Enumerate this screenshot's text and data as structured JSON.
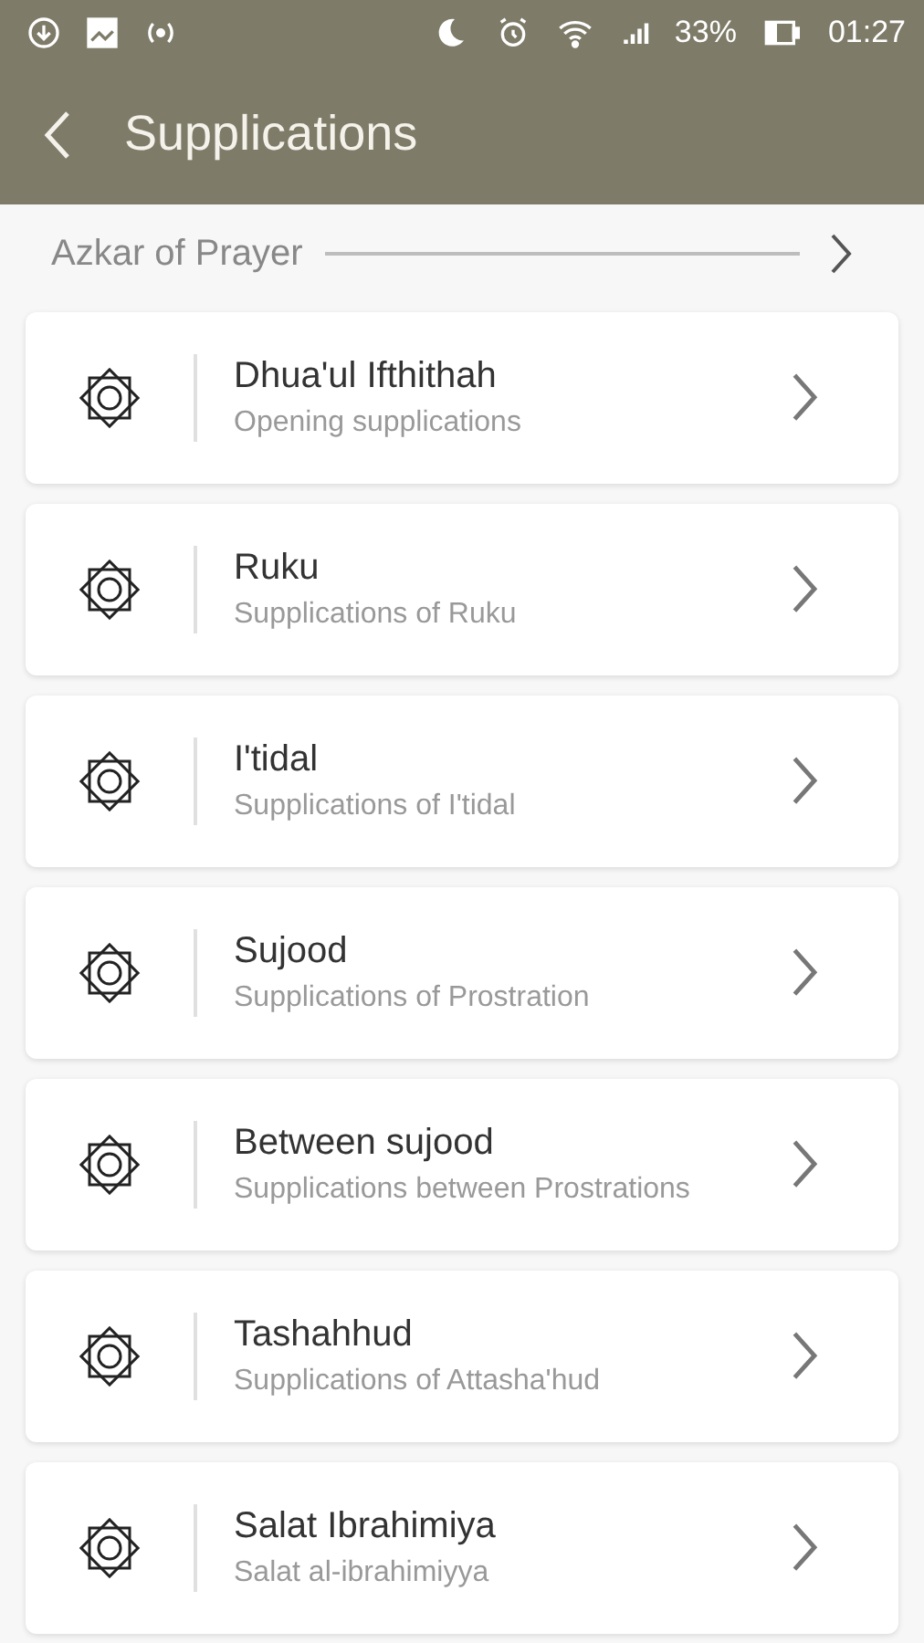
{
  "status_bar": {
    "battery": "33%",
    "time": "01:27"
  },
  "app_bar": {
    "title": "Supplications"
  },
  "section": {
    "title": "Azkar of Prayer"
  },
  "items": [
    {
      "title": "Dhua'ul Ifthithah",
      "subtitle": "Opening supplications"
    },
    {
      "title": "Ruku",
      "subtitle": "Supplications of Ruku"
    },
    {
      "title": "I'tidal",
      "subtitle": "Supplications of I'tidal"
    },
    {
      "title": "Sujood",
      "subtitle": "Supplications of Prostration"
    },
    {
      "title": "Between sujood",
      "subtitle": "Supplications between Prostrations"
    },
    {
      "title": "Tashahhud",
      "subtitle": "Supplications of Attasha'hud"
    },
    {
      "title": "Salat Ibrahimiya",
      "subtitle": "Salat al-ibrahimiyya"
    }
  ]
}
